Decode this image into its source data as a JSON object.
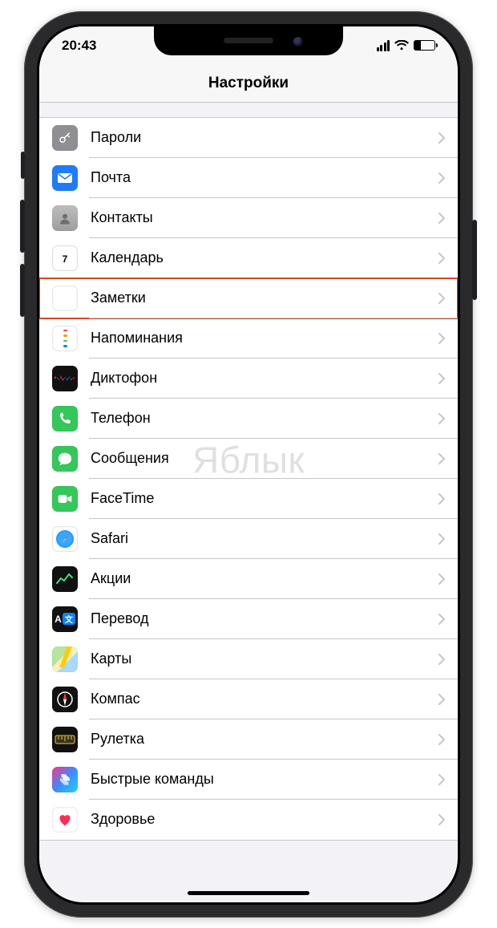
{
  "status": {
    "time": "20:43"
  },
  "nav": {
    "title": "Настройки"
  },
  "watermark": "Яблык",
  "rows": [
    {
      "id": "passwords",
      "label": "Пароли",
      "icon": "key-icon",
      "highlight": false
    },
    {
      "id": "mail",
      "label": "Почта",
      "icon": "mail-icon",
      "highlight": false
    },
    {
      "id": "contacts",
      "label": "Контакты",
      "icon": "contacts-icon",
      "highlight": false
    },
    {
      "id": "calendar",
      "label": "Календарь",
      "icon": "calendar-icon",
      "highlight": false
    },
    {
      "id": "notes",
      "label": "Заметки",
      "icon": "notes-icon",
      "highlight": true
    },
    {
      "id": "reminders",
      "label": "Напоминания",
      "icon": "reminders-icon",
      "highlight": false
    },
    {
      "id": "voicememo",
      "label": "Диктофон",
      "icon": "voicememo-icon",
      "highlight": false
    },
    {
      "id": "phone",
      "label": "Телефон",
      "icon": "phone-icon",
      "highlight": false
    },
    {
      "id": "messages",
      "label": "Сообщения",
      "icon": "messages-icon",
      "highlight": false
    },
    {
      "id": "facetime",
      "label": "FaceTime",
      "icon": "facetime-icon",
      "highlight": false
    },
    {
      "id": "safari",
      "label": "Safari",
      "icon": "safari-icon",
      "highlight": false
    },
    {
      "id": "stocks",
      "label": "Акции",
      "icon": "stocks-icon",
      "highlight": false
    },
    {
      "id": "translate",
      "label": "Перевод",
      "icon": "translate-icon",
      "highlight": false
    },
    {
      "id": "maps",
      "label": "Карты",
      "icon": "maps-icon",
      "highlight": false
    },
    {
      "id": "compass",
      "label": "Компас",
      "icon": "compass-icon",
      "highlight": false
    },
    {
      "id": "measure",
      "label": "Рулетка",
      "icon": "measure-icon",
      "highlight": false
    },
    {
      "id": "shortcuts",
      "label": "Быстрые команды",
      "icon": "shortcuts-icon",
      "highlight": false
    },
    {
      "id": "health",
      "label": "Здоровье",
      "icon": "health-icon",
      "highlight": false
    }
  ]
}
